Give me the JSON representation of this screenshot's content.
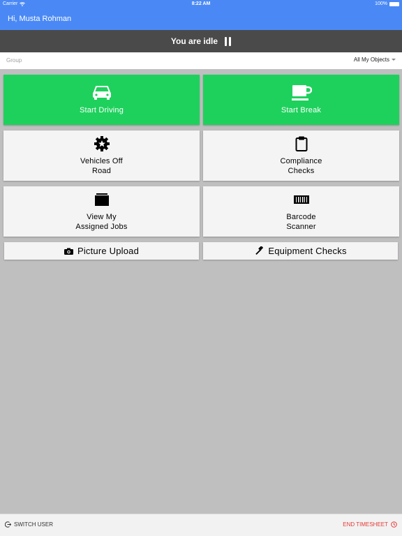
{
  "status_bar": {
    "carrier": "Carrier",
    "time": "8:22 AM",
    "battery": "100%"
  },
  "header": {
    "greeting": "Hi, Musta Rohman"
  },
  "idle_bar": {
    "status": "You are idle"
  },
  "group_bar": {
    "label": "Group",
    "selected": "All My Objects"
  },
  "tiles": {
    "start_driving": {
      "label": "Start Driving",
      "icon": "car-icon"
    },
    "start_break": {
      "label": "Start Break",
      "icon": "coffee-cup-icon"
    },
    "vehicles_off_road": {
      "label": "Vehicles Off\nRoad",
      "icon": "gear-star-icon"
    },
    "compliance_checks": {
      "label": "Compliance\nChecks",
      "icon": "clipboard-icon"
    },
    "assigned_jobs": {
      "label": "View My\nAssigned Jobs",
      "icon": "folder-icon"
    },
    "barcode_scanner": {
      "label": "Barcode\nScanner",
      "icon": "barcode-icon"
    }
  },
  "strips": {
    "picture_upload": {
      "label": "Picture Upload",
      "icon": "camera-icon"
    },
    "equipment_checks": {
      "label": "Equipment Checks",
      "icon": "hammer-icon"
    }
  },
  "footer": {
    "switch_user": "SWITCH USER",
    "end_timesheet": "END TIMESHEET"
  },
  "colors": {
    "brand_blue": "#4a89f5",
    "active_green": "#1ed15c",
    "idle_dark": "#4a4a4a",
    "danger_red": "#e53935"
  }
}
